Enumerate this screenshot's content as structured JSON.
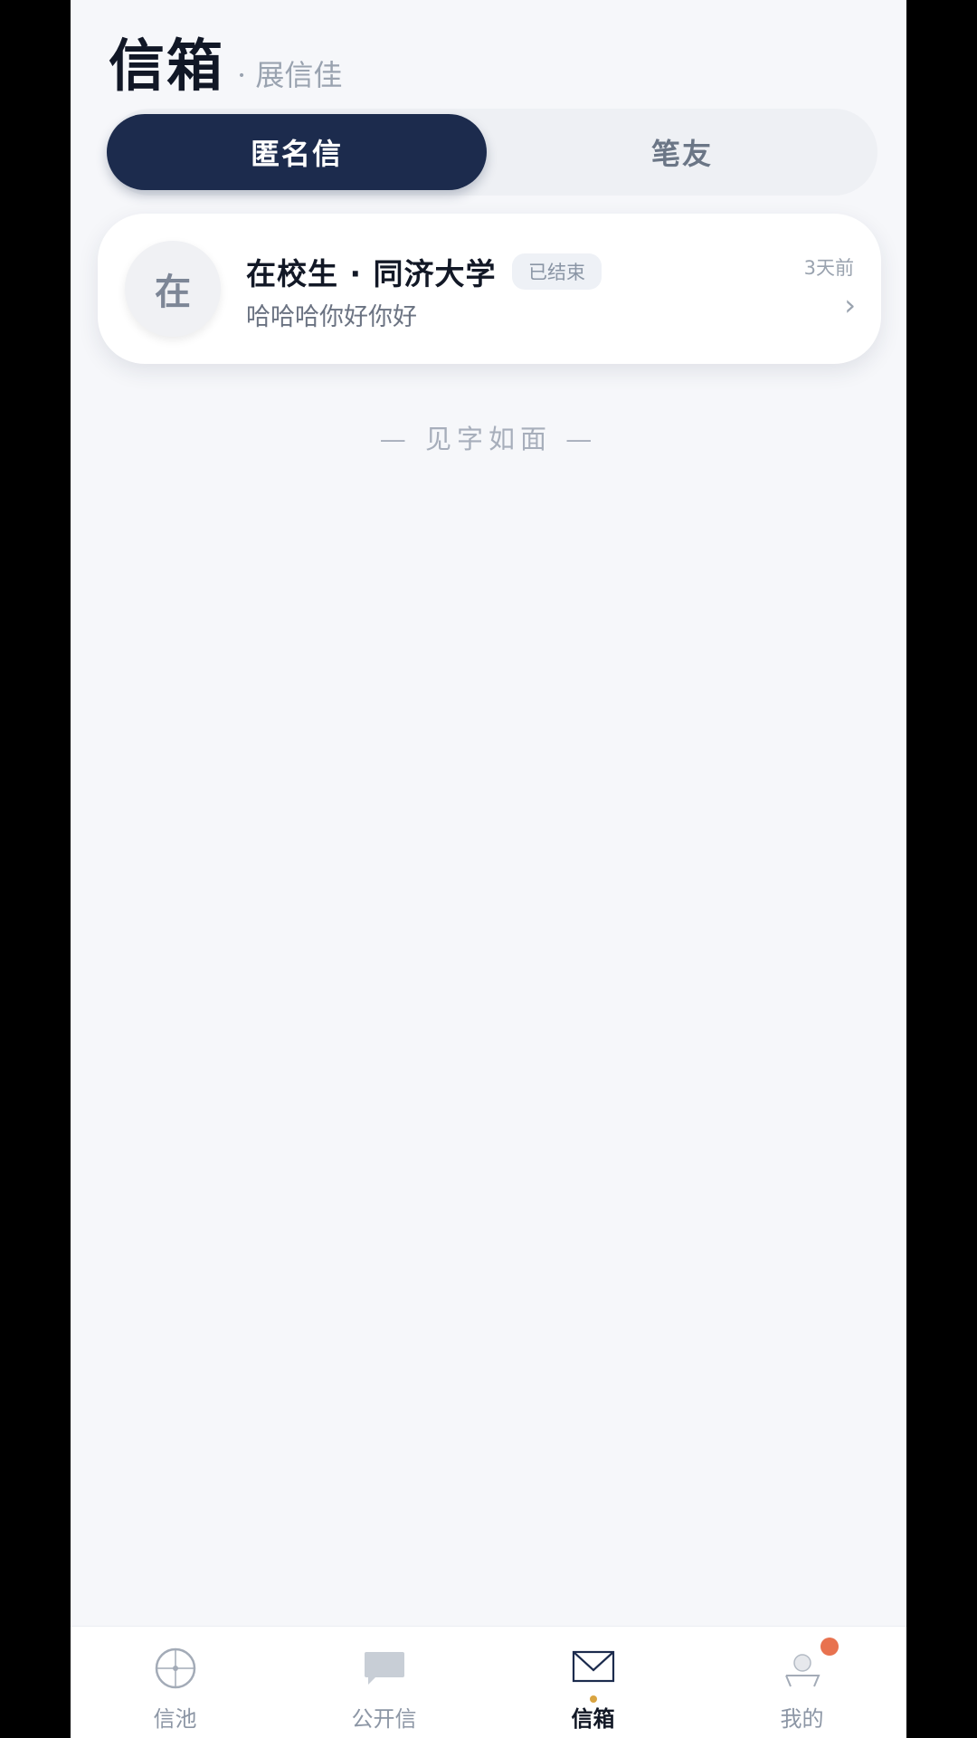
{
  "header": {
    "title": "信箱",
    "subtitle": "· 展信佳"
  },
  "tabs": [
    {
      "label": "匿名信",
      "active": true
    },
    {
      "label": "笔友",
      "active": false
    }
  ],
  "letters": [
    {
      "avatar": "在",
      "title": "在校生 · 同济大学",
      "badge": "已结束",
      "preview": "哈哈哈你好你好",
      "time": "3天前",
      "chevron": "›"
    }
  ],
  "footer_note": "— 见字如面 —",
  "nav": {
    "items": [
      {
        "label": "信池",
        "icon": "compass-icon",
        "active": false
      },
      {
        "label": "公开信",
        "icon": "chat-bubble-icon",
        "active": false
      },
      {
        "label": "信箱",
        "icon": "envelope-icon",
        "active": true
      },
      {
        "label": "我的",
        "icon": "person-icon",
        "active": false,
        "notification": true
      }
    ]
  },
  "colors": {
    "accent": "#1c2b4d",
    "active_dot": "#d9a441",
    "notification": "#e8724f"
  }
}
